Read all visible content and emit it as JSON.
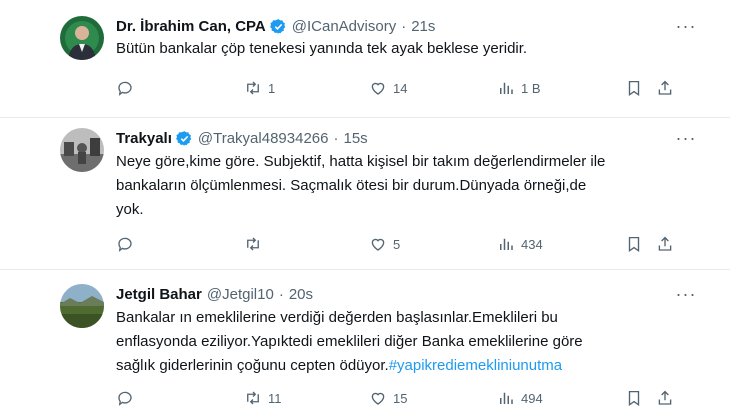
{
  "tweets": [
    {
      "name": "Dr. İbrahim Can, CPA",
      "handle": "@ICanAdvisory",
      "time": "21s",
      "verified": true,
      "text_lines": [
        "Bütün bankalar çöp tenekesi yanında tek ayak beklese yeridir."
      ],
      "hashtag": "",
      "replies": "",
      "retweets": "1",
      "likes": "14",
      "views": "1 B"
    },
    {
      "name": "Trakyalı",
      "handle": "@Trakyal48934266",
      "time": "15s",
      "verified": true,
      "text_lines": [
        "Neye göre,kime göre. Subjektif, hatta kişisel bir takım değerlendirmeler ile",
        "bankaların ölçümlenmesi. Saçmalık ötesi bir durum.Dünyada örneği,de",
        "yok."
      ],
      "hashtag": "",
      "replies": "",
      "retweets": "",
      "likes": "5",
      "views": "434"
    },
    {
      "name": "Jetgil Bahar",
      "handle": "@Jetgil10",
      "time": "20s",
      "verified": false,
      "text_lines": [
        "Bankalar ın emeklilerine verdiği değerden başlasınlar.Emeklileri bu",
        "enflasyonda eziliyor.Yapıktedi emeklileri diğer Banka emeklilerine göre",
        "sağlık giderlerinin çoğunu cepten ödüyor."
      ],
      "hashtag": "#yapikrediemekliniunutma",
      "replies": "",
      "retweets": "11",
      "likes": "15",
      "views": "494"
    }
  ],
  "icons": {
    "more": "more-options-icon",
    "reply": "reply-icon",
    "retweet": "retweet-icon",
    "like": "heart-icon",
    "views": "views-icon",
    "bookmark": "bookmark-icon",
    "share": "share-icon",
    "verified": "verified-badge-icon"
  },
  "colors": {
    "text": "#0f1419",
    "secondary": "#536471",
    "accent": "#1d9bf0",
    "divider": "#e6ecf0"
  }
}
